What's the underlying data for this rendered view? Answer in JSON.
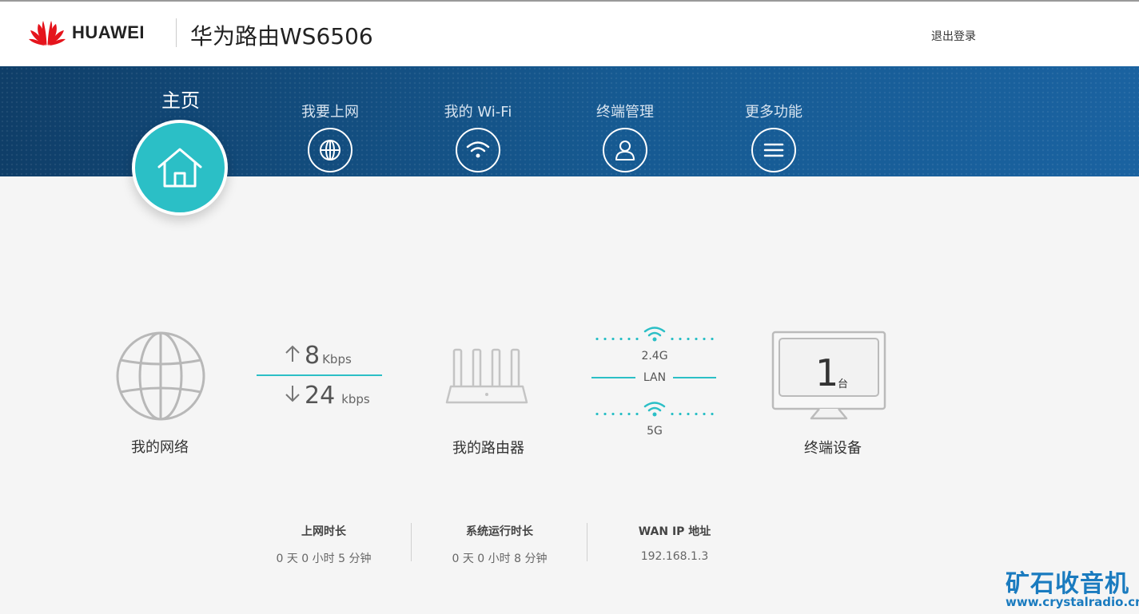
{
  "header": {
    "brand": "HUAWEI",
    "product_title": "华为路由WS6506",
    "logout": "退出登录",
    "brand_color": "#e5141c"
  },
  "nav": {
    "home": "主页",
    "items": [
      {
        "label": "我要上网",
        "icon": "globe-icon"
      },
      {
        "label": "我的 Wi-Fi",
        "icon": "wifi-icon"
      },
      {
        "label": "终端管理",
        "icon": "user-icon"
      },
      {
        "label": "更多功能",
        "icon": "menu-icon"
      }
    ],
    "accent": "#2bbfc6"
  },
  "topology": {
    "network_label": "我的网络",
    "upload_value": "8",
    "upload_unit": "Kbps",
    "download_value": "24",
    "download_unit": "kbps",
    "router_label": "我的路由器",
    "band_24": "2.4G",
    "lan": "LAN",
    "band_5": "5G",
    "device_count": "1",
    "device_unit": "台",
    "device_label": "终端设备"
  },
  "stats": [
    {
      "label": "上网时长",
      "value": "0 天 0 小时 5 分钟"
    },
    {
      "label": "系统运行时长",
      "value": "0 天 0 小时 8 分钟"
    },
    {
      "label": "WAN IP 地址",
      "value": "192.168.1.3"
    }
  ],
  "watermark": {
    "title": "矿石收音机",
    "url": "www.crystalradio.cn"
  }
}
